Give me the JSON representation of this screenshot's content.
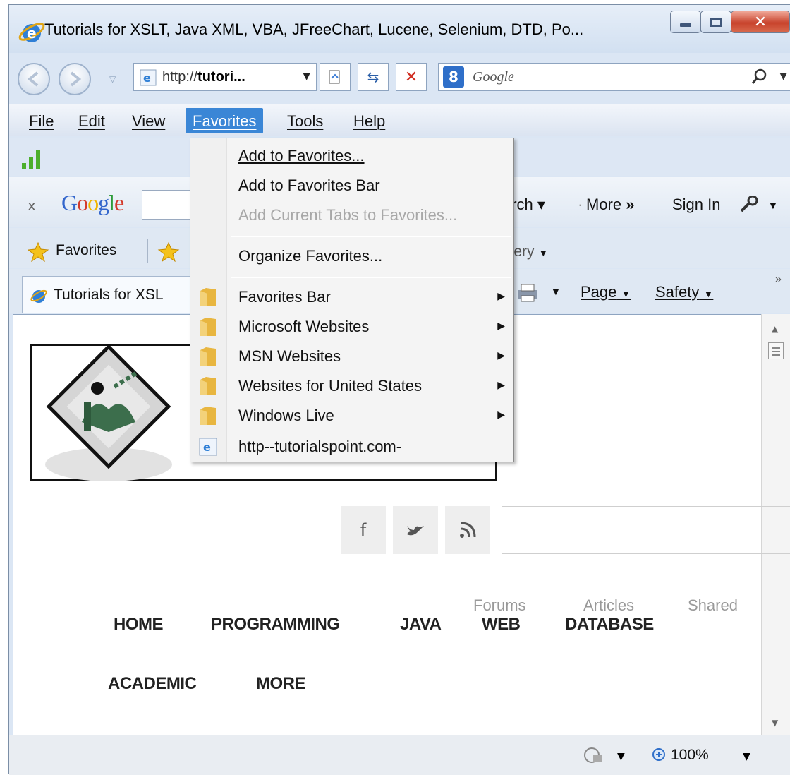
{
  "window": {
    "title": "Tutorials for XSLT, Java XML, VBA, JFreeChart, Lucene, Selenium, DTD, Po..."
  },
  "address_bar": {
    "url_prefix": "http://",
    "url_host": "tutori...",
    "search_placeholder": "Google",
    "search_badge": "8"
  },
  "menubar": {
    "items": [
      "File",
      "Edit",
      "View",
      "Favorites",
      "Tools",
      "Help"
    ],
    "active": "Favorites"
  },
  "google_toolbar": {
    "close": "x",
    "logo": "Google",
    "search_fragment": "arch",
    "more_label": "More",
    "more_glyph": "»",
    "sign_in": "Sign In"
  },
  "favorites_bar": {
    "favorites_label": "Favorites",
    "gallery_fragment": "llery"
  },
  "tab_bar": {
    "tab_title": "Tutorials for XSL",
    "page_label": "Page",
    "safety_label": "Safety",
    "overflow": "»"
  },
  "favorites_menu": {
    "add": "Add to Favorites...",
    "add_bar": "Add to Favorites Bar",
    "add_tabs": "Add Current Tabs to Favorites...",
    "organize": "Organize Favorites...",
    "folders": [
      "Favorites Bar",
      "Microsoft Websites",
      "MSN Websites",
      "Websites for United States",
      "Windows Live"
    ],
    "link": "http--tutorialspoint.com-"
  },
  "page": {
    "social": {
      "facebook": "f",
      "twitter": "t",
      "rss": "rss"
    },
    "nav": {
      "home": "HOME",
      "programming": "PROGRAMMING",
      "java": "JAVA",
      "web": "WEB",
      "database": "DATABASE",
      "academic": "ACADEMIC",
      "more": "MORE",
      "forums": "Forums",
      "articles": "Articles",
      "shared": "Shared"
    }
  },
  "statusbar": {
    "zoom": "100%"
  },
  "colors": {
    "menu_highlight": "#3a86d6",
    "logo_green": "#3c6e4c",
    "signal_green": "#4caf2c",
    "close_button": "#c8432c"
  },
  "icons": [
    "ie-icon",
    "back-icon",
    "forward-icon",
    "refresh-icon",
    "stop-icon",
    "search-icon",
    "signal-icon",
    "star-icon",
    "folder-icon",
    "wrench-icon",
    "print-icon",
    "rss-icon",
    "zoom-icon"
  ]
}
